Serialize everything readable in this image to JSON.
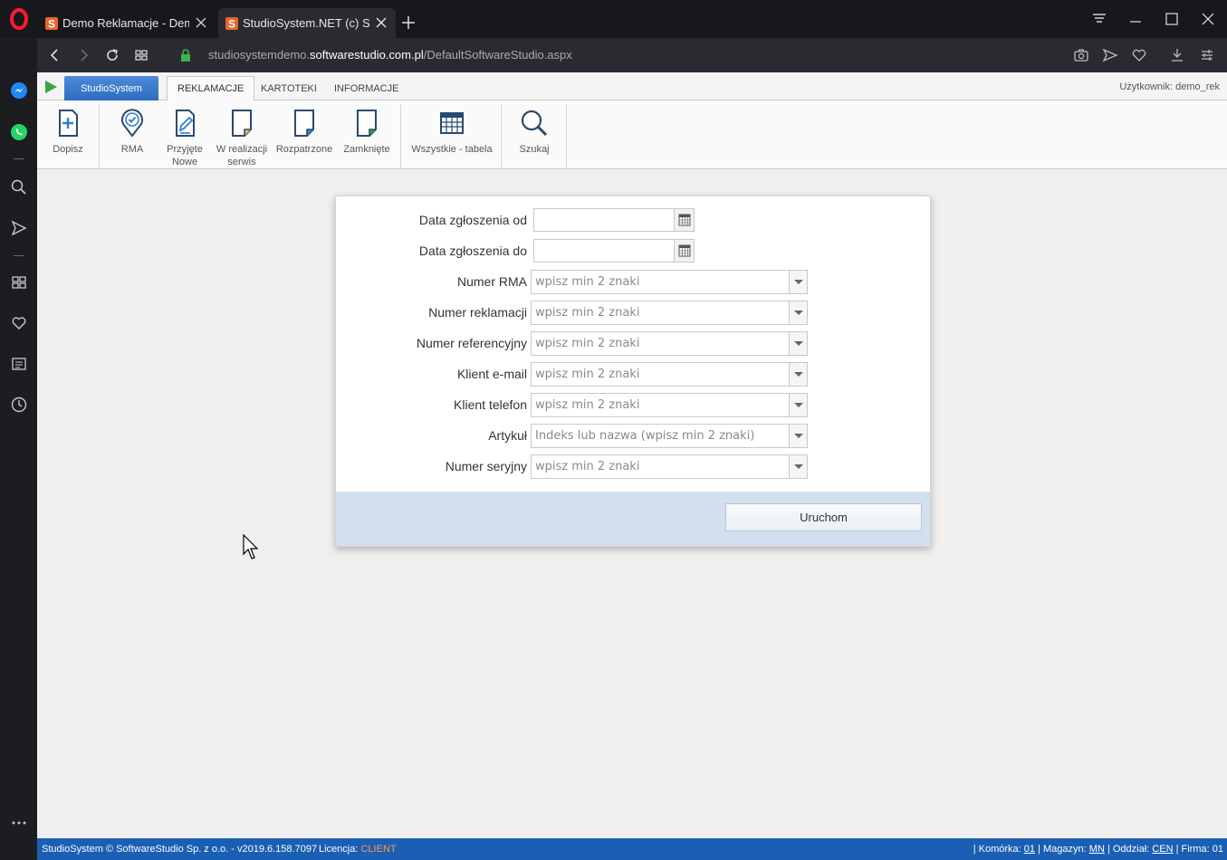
{
  "browser": {
    "tabs": [
      {
        "title": "Demo Reklamacje - Demo",
        "active": false
      },
      {
        "title": "StudioSystem.NET (c) Softw",
        "active": true
      }
    ],
    "url_prefix": "studiosystemdemo.",
    "url_domain": "softwarestudio.com.pl",
    "url_path": "/DefaultSoftwareStudio.aspx"
  },
  "app": {
    "brand": "StudioSystem",
    "menu": [
      "REKLAMACJE",
      "KARTOTEKI",
      "INFORMACJE"
    ],
    "user": "Użytkownik: demo_rek",
    "ribbon": [
      {
        "icon": "document-add-icon",
        "label": "Dopisz"
      },
      {
        "icon": "location-check-icon",
        "label": "RMA"
      },
      {
        "icon": "document-edit-icon",
        "label": "Przyjęte Nowe"
      },
      {
        "icon": "document-icon",
        "label": "W realizacji serwis"
      },
      {
        "icon": "document-icon",
        "label": "Rozpatrzone"
      },
      {
        "icon": "document-icon",
        "label": "Zamknięte"
      },
      {
        "icon": "table-icon",
        "label": "Wszystkie - tabela"
      },
      {
        "icon": "search-icon",
        "label": "Szukaj"
      }
    ]
  },
  "form": {
    "date_from_label": "Data zgłoszenia od",
    "date_to_label": "Data zgłoszenia do",
    "fields": [
      {
        "label": "Numer RMA",
        "placeholder": "wpisz min 2 znaki"
      },
      {
        "label": "Numer reklamacji",
        "placeholder": "wpisz min 2 znaki"
      },
      {
        "label": "Numer referencyjny",
        "placeholder": "wpisz min 2 znaki"
      },
      {
        "label": "Klient e-mail",
        "placeholder": "wpisz min 2 znaki"
      },
      {
        "label": "Klient telefon",
        "placeholder": "wpisz min 2 znaki"
      },
      {
        "label": "Artykuł",
        "placeholder": "Indeks lub nazwa (wpisz min 2 znaki)"
      },
      {
        "label": "Numer seryjny",
        "placeholder": "wpisz min 2 znaki"
      }
    ],
    "submit_label": "Uruchom"
  },
  "status": {
    "left": "StudioSystem © SoftwareStudio Sp. z o.o. - v2019.6.158.7097",
    "license_label": "Licencja:",
    "license_value": "CLIENT",
    "komorka_label": "Komórka:",
    "komorka": "01",
    "magazyn_label": "Magazyn:",
    "magazyn": "MN",
    "oddzial_label": "Oddział:",
    "oddzial": "CEN",
    "firma_label": "Firma:",
    "firma": "01"
  }
}
